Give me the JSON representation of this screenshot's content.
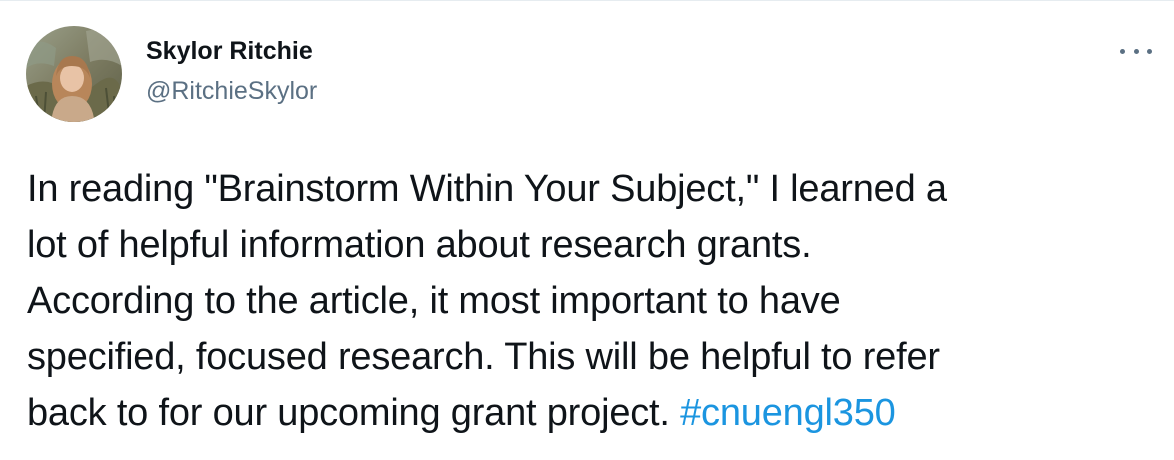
{
  "tweet": {
    "author": {
      "display_name": "Skylor Ritchie",
      "handle": "@RitchieSkylor"
    },
    "more_icon": "more-horizontal-icon",
    "text_lines": [
      "In reading \"Brainstorm Within Your Subject,\" I learned a",
      "lot of helpful information about research grants.",
      "According to the article, it most important to have",
      "specified, focused research. This will be helpful to refer",
      "back to for our upcoming grant project. "
    ],
    "hashtag": "#cnuengl350",
    "colors": {
      "text": "#0f1419",
      "secondary": "#5b7083",
      "link": "#1b95e0",
      "divider": "#e6ecf0"
    }
  }
}
